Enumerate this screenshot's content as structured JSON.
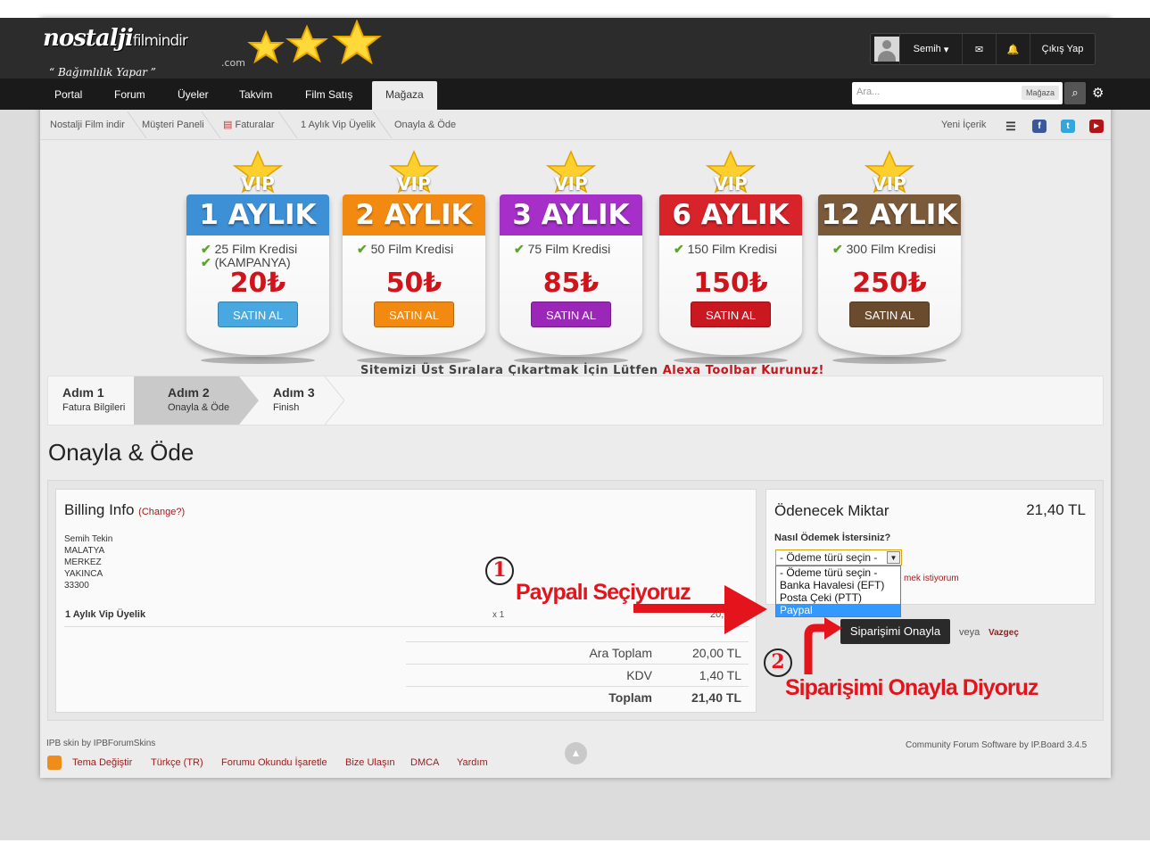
{
  "brand": {
    "logo_main": "nostalji",
    "logo_sub": "filmindir",
    "logo_dotcom": ".com",
    "slogan": "“ Bağımlılık Yapar ”"
  },
  "user": {
    "name": "Semih",
    "logout": "Çıkış Yap"
  },
  "nav": {
    "tabs": [
      "Portal",
      "Forum",
      "Üyeler",
      "Takvim",
      "Film Satış",
      "Mağaza"
    ],
    "active": "Mağaza"
  },
  "search": {
    "placeholder": "Ara...",
    "scope": "Mağaza"
  },
  "breadcrumb": [
    "Nostalji Film indir",
    "Müşteri Paneli",
    "Faturalar",
    "1 Aylık Vip Üyelik",
    "Onayla & Öde"
  ],
  "new_content": "Yeni İçerik",
  "vip_word": "VIP",
  "vip_cards": [
    {
      "title": "1 AYLIK",
      "features": [
        "25 Film Kredisi",
        "(KAMPANYA)"
      ],
      "price": "20₺",
      "buy": "SATIN AL",
      "color": "#3d8fd6",
      "btn": "#4aa8e0"
    },
    {
      "title": "2 AYLIK",
      "features": [
        "50 Film Kredisi"
      ],
      "price": "50₺",
      "buy": "SATIN AL",
      "color": "#f28a12",
      "btn": "#f28a12"
    },
    {
      "title": "3 AYLIK",
      "features": [
        "75 Film Kredisi"
      ],
      "price": "85₺",
      "buy": "SATIN AL",
      "color": "#a62fc9",
      "btn": "#9b27b8"
    },
    {
      "title": "6 AYLIK",
      "features": [
        "150 Film Kredisi"
      ],
      "price": "150₺",
      "buy": "SATIN AL",
      "color": "#d9232b",
      "btn": "#c91820"
    },
    {
      "title": "12 AYLIK",
      "features": [
        "300 Film Kredisi"
      ],
      "price": "250₺",
      "buy": "SATIN AL",
      "color": "#7b5a3a",
      "btn": "#6a4b2d"
    }
  ],
  "alexa": {
    "text": "Sitemizi Üst Sıralara Çıkartmak İçin Lütfen ",
    "link": "Alexa Toolbar Kurunuz!"
  },
  "steps": [
    {
      "title": "Adım 1",
      "sub": "Fatura Bilgileri"
    },
    {
      "title": "Adım 2",
      "sub": "Onayla & Öde"
    },
    {
      "title": "Adım 3",
      "sub": "Finish"
    }
  ],
  "page_title": "Onayla & Öde",
  "billing": {
    "title": "Billing Info",
    "change": "(Change?)",
    "address": [
      "Semih Tekin",
      "MALATYA",
      "MERKEZ",
      "YAKINCA",
      "33300"
    ],
    "item": "1 Aylık Vip Üyelik",
    "qty": "x 1",
    "item_amount": "20,00",
    "totals": [
      {
        "label": "Ara Toplam",
        "value": "20,00 TL"
      },
      {
        "label": "KDV",
        "value": "1,40 TL"
      },
      {
        "label": "Toplam",
        "value": "21,40 TL"
      }
    ]
  },
  "payment": {
    "label": "Ödenecek Miktar",
    "amount": "21,40 TL",
    "question": "Nasıl Ödemek İstersiniz?",
    "selected": "- Ödeme türü seçin -",
    "options": [
      "- Ödeme türü seçin -",
      "Banka Havalesi (EFT)",
      "Posta Çeki (PTT)",
      "Paypal"
    ],
    "highlighted": "Paypal",
    "note_fragment": "mek istiyorum",
    "confirm": "Siparişimi Onayla",
    "or": "veya",
    "cancel": "Vazgeç"
  },
  "annotations": {
    "one": "1",
    "two": "2",
    "paypal": "Paypalı Seçiyoruz",
    "confirm": "Siparişimi Onayla Diyoruz"
  },
  "footer": {
    "skin": "IPB skin by IPBForumSkins",
    "links": [
      "Tema Değiştir",
      "Türkçe (TR)",
      "Forumu Okundu İşaretle",
      "Bize Ulaşın",
      "DMCA",
      "Yardım"
    ],
    "right": "Community Forum Software by IP.Board 3.4.5"
  },
  "colors": {
    "accent_red": "#e3141b",
    "link": "#a01c1c",
    "header": "#2c2c2c"
  }
}
